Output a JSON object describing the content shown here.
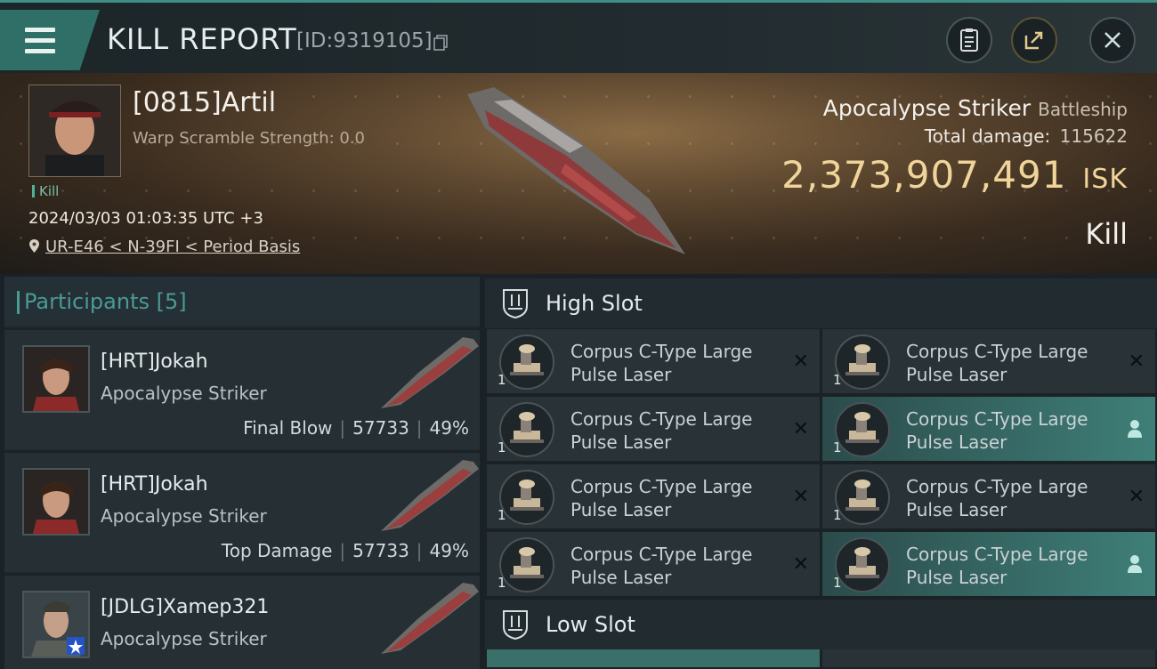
{
  "header": {
    "title": "KILL REPORT",
    "report_id": "[ID:9319105]",
    "icons": [
      "menu-icon",
      "copy-icon",
      "clipboard-icon",
      "share-icon",
      "close-icon"
    ]
  },
  "victim": {
    "name": "[0815]Artil",
    "warp_scramble": "Warp Scramble Strength: 0.0",
    "tag": "Kill",
    "datetime": "2024/03/03 01:03:35 UTC +3",
    "location": "UR-E46 < N-39FI < Period Basis",
    "ship_name": "Apocalypse Striker",
    "ship_class": "Battleship",
    "total_damage_label": "Total damage:",
    "total_damage_value": "115622",
    "isk_value": "2,373,907,491",
    "isk_unit": "ISK",
    "result": "Kill"
  },
  "participants": {
    "label": "Participants",
    "count": "[5]",
    "rows": [
      {
        "name": "[HRT]Jokah",
        "ship": "Apocalypse Striker",
        "role": "Final Blow",
        "damage": "57733",
        "percent": "49%"
      },
      {
        "name": "[HRT]Jokah",
        "ship": "Apocalypse Striker",
        "role": "Top Damage",
        "damage": "57733",
        "percent": "49%"
      },
      {
        "name": "[JDLG]Xamep321",
        "ship": "Apocalypse Striker",
        "role": "",
        "damage": "",
        "percent": ""
      }
    ]
  },
  "slots": {
    "high_label": "High Slot",
    "low_label": "Low Slot",
    "modules": [
      {
        "line1": "Corpus C-Type Large",
        "line2": "Pulse Laser",
        "qty": "1",
        "state": "destroyed"
      },
      {
        "line1": "Corpus C-Type Large",
        "line2": "Pulse Laser",
        "qty": "1",
        "state": "destroyed"
      },
      {
        "line1": "Corpus C-Type Large",
        "line2": "Pulse Laser",
        "qty": "1",
        "state": "destroyed"
      },
      {
        "line1": "Corpus C-Type Large",
        "line2": "Pulse Laser",
        "qty": "1",
        "state": "dropped"
      },
      {
        "line1": "Corpus C-Type Large",
        "line2": "Pulse Laser",
        "qty": "1",
        "state": "destroyed"
      },
      {
        "line1": "Corpus C-Type Large",
        "line2": "Pulse Laser",
        "qty": "1",
        "state": "destroyed"
      },
      {
        "line1": "Corpus C-Type Large",
        "line2": "Pulse Laser",
        "qty": "1",
        "state": "destroyed"
      },
      {
        "line1": "Corpus C-Type Large",
        "line2": "Pulse Laser",
        "qty": "1",
        "state": "dropped"
      }
    ]
  },
  "colors": {
    "accent_teal": "#3f8f86",
    "isk_gold": "#f0d59a",
    "dropped_highlight": "#3f7f78"
  }
}
